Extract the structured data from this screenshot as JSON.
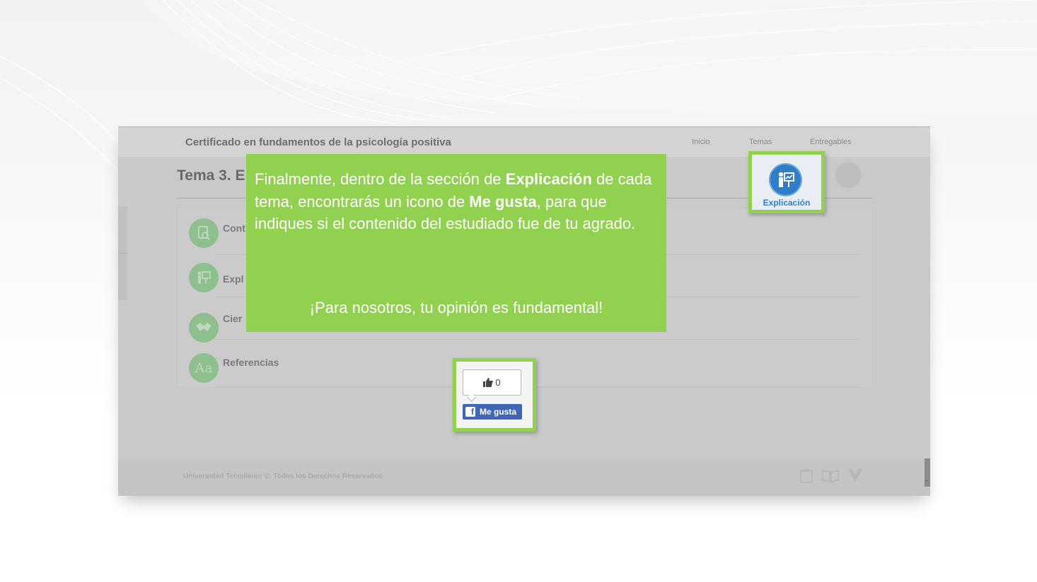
{
  "header": {
    "course_title": "Certificado en fundamentos de la psicología positiva",
    "nav": [
      "Inicio",
      "Temas",
      "Entregables"
    ]
  },
  "tema": {
    "title": "Tema 3. E"
  },
  "sections": [
    {
      "label": "Cont",
      "icon": "document-search-icon"
    },
    {
      "label": "Expl",
      "icon": "teacher-board-icon"
    },
    {
      "label": "Cier",
      "icon": "handshake-icon"
    },
    {
      "label": "Referencias",
      "icon": "typography-aa-icon",
      "glyph": "Aa"
    }
  ],
  "explicacion_button": {
    "label": "Explicación",
    "icon": "teacher-board-icon"
  },
  "tip": {
    "part1": "Finalmente, dentro de la sección de ",
    "bold1": "Explicación",
    "part2": " de cada tema, encontrarás un icono de ",
    "bold2": "Me gusta",
    "part3": ", para que indiques si el contenido del estudiado fue de tu agrado.",
    "footer": "¡Para nosotros, tu opinión es fundamental!"
  },
  "like_widget": {
    "count": "0",
    "button_label": "Me gusta",
    "icon": "thumbs-up-icon"
  },
  "footer": {
    "text": "Universidad Tecmilenio ©. Todos los Derechos Reservados"
  },
  "colors": {
    "highlight": "#92d050",
    "accent_blue": "#2f7ec7",
    "facebook": "#4267b2"
  }
}
